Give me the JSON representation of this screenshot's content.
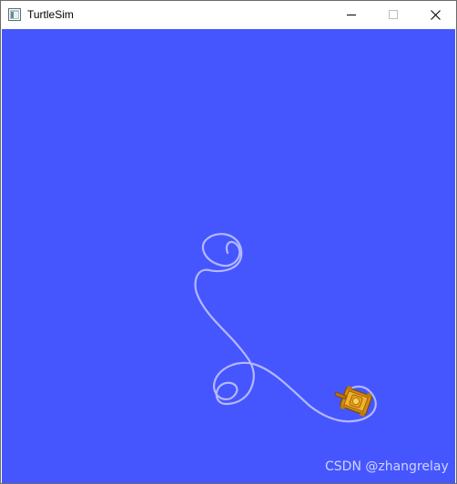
{
  "window": {
    "title": "TurtleSim"
  },
  "titlebar_buttons": {
    "minimize_icon": "minimize-icon",
    "maximize_icon": "maximize-icon",
    "close_icon": "close-icon"
  },
  "canvas": {
    "background_color": "#4556ff",
    "trail_color": "#b3b8ff",
    "turtle_icon": "turtle-icon"
  },
  "watermark": {
    "text": "CSDN @zhangrelay"
  }
}
